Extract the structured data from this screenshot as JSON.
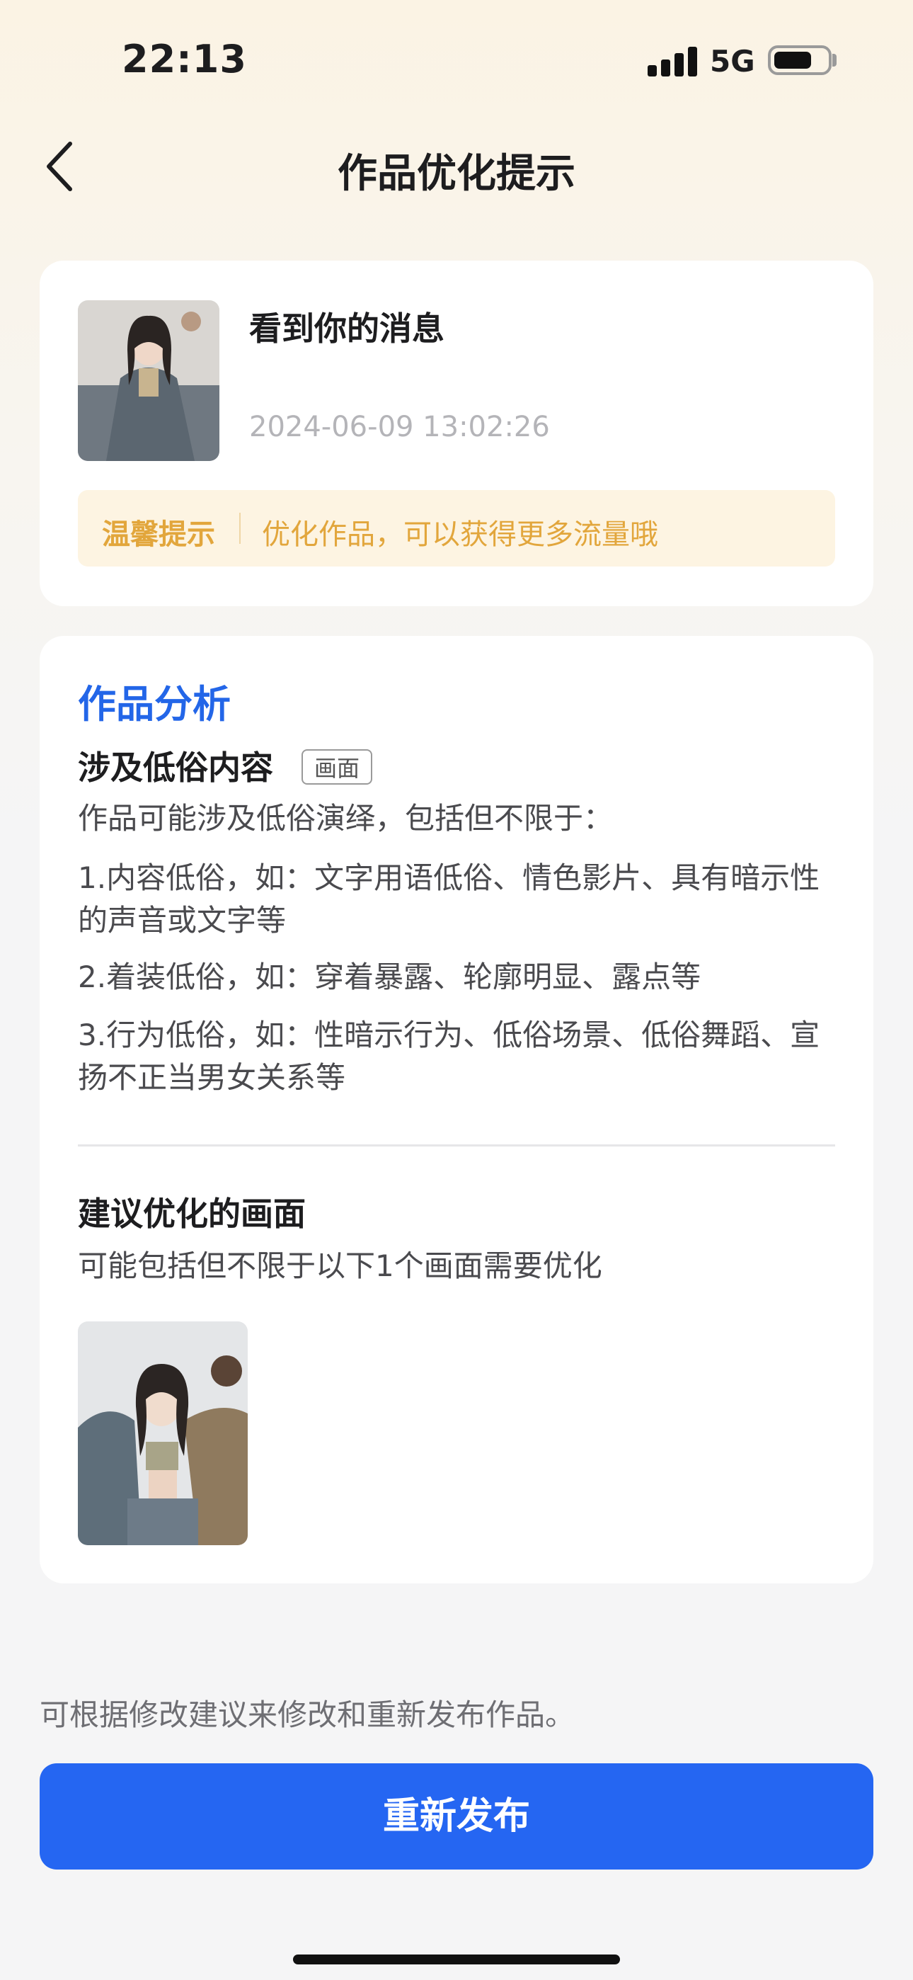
{
  "status_bar": {
    "time": "22:13",
    "network": "5G"
  },
  "nav": {
    "title": "作品优化提示"
  },
  "work": {
    "title": "看到你的消息",
    "date": "2024-06-09 13:02:26",
    "tip_label": "温馨提示",
    "tip_text": "优化作品，可以获得更多流量哦"
  },
  "analysis": {
    "heading": "作品分析",
    "issue_title": "涉及低俗内容",
    "issue_tag": "画面",
    "intro": "作品可能涉及低俗演绎，包括但不限于：",
    "rules": [
      "1.内容低俗，如：文字用语低俗、情色影片、具有暗示性的声音或文字等",
      "2.着装低俗，如：穿着暴露、轮廓明显、露点等",
      "3.行为低俗，如：性暗示行为、低俗场景、低俗舞蹈、宣扬不正当男女关系等"
    ],
    "suggest_title": "建议优化的画面",
    "suggest_text": "可能包括但不限于以下1个画面需要优化"
  },
  "footer": {
    "hint": "可根据修改建议来修改和重新发布作品。",
    "button_label": "重新发布"
  },
  "colors": {
    "accent": "#2566f2",
    "heading_blue": "#2366e8",
    "tip_orange": "#e2a63c"
  }
}
